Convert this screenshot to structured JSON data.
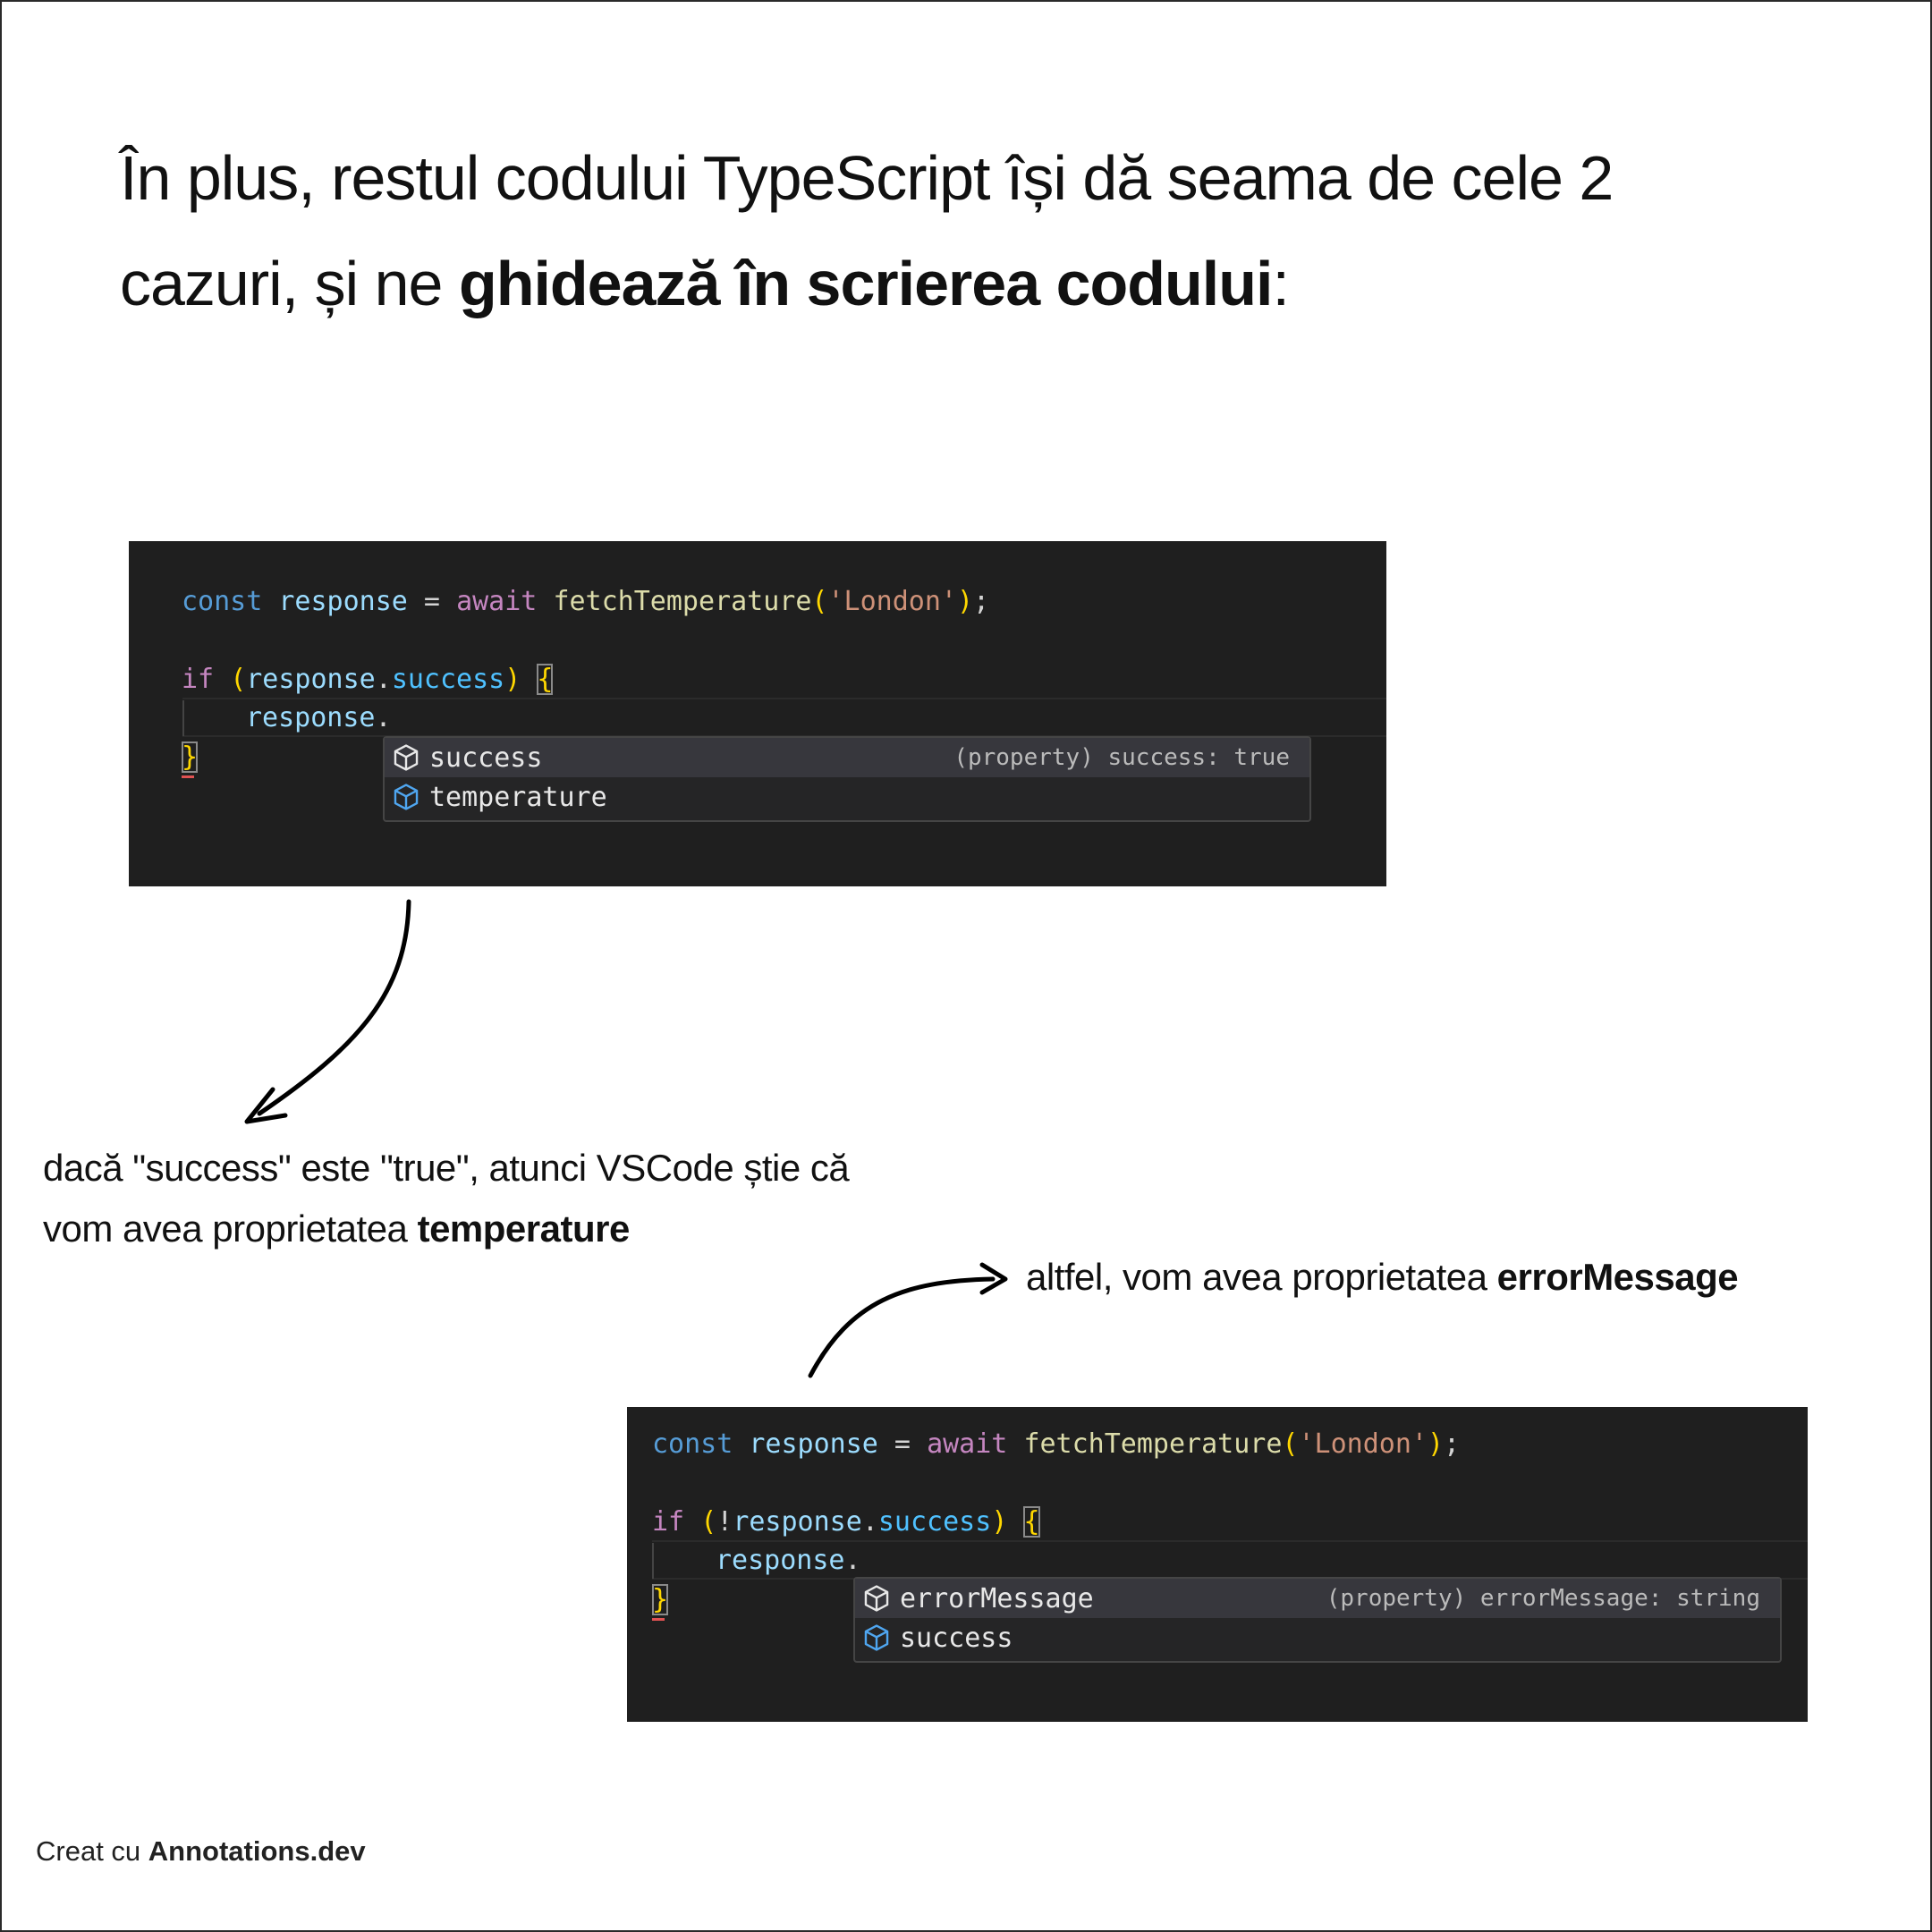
{
  "headline": {
    "line1": "În plus,  restul codului TypeScript își dă seama de cele 2",
    "line2_start": "cazuri, și ne ",
    "line2_bold": "ghidează în scrierea codului",
    "line2_end": ":"
  },
  "code_block_1": {
    "l1": {
      "const": "const",
      "response": "response",
      "eq": " = ",
      "await": "await",
      "fn": "fetchTemperature",
      "open": "(",
      "str": "'London'",
      "close": ")",
      "semi": ";"
    },
    "l2": {
      "if": "if",
      "open": "(",
      "bang": "",
      "var": "response",
      "dot": ".",
      "prop": "success",
      "close": ")",
      "brace": "{"
    },
    "l3": {
      "var": "response",
      "dot": "."
    },
    "l4": {
      "brace": "}"
    },
    "suggestions": [
      {
        "label": "success",
        "detail": "(property) success: true",
        "selected": true
      },
      {
        "label": "temperature",
        "detail": "",
        "selected": false
      }
    ]
  },
  "code_block_2": {
    "l1": {
      "const": "const",
      "response": "response",
      "eq": " = ",
      "await": "await",
      "fn": "fetchTemperature",
      "open": "(",
      "str": "'London'",
      "close": ")",
      "semi": ";"
    },
    "l2": {
      "if": "if",
      "open": "(",
      "bang": "!",
      "var": "response",
      "dot": ".",
      "prop": "success",
      "close": ")",
      "brace": "{"
    },
    "l3": {
      "var": "response",
      "dot": "."
    },
    "l4": {
      "brace": "}"
    },
    "suggestions": [
      {
        "label": "errorMessage",
        "detail": "(property) errorMessage: string",
        "selected": true
      },
      {
        "label": "success",
        "detail": "",
        "selected": false
      }
    ]
  },
  "note_1": {
    "line1": "dacă \"success\" este \"true\", atunci VSCode știe că",
    "line2_start": "vom avea proprietatea ",
    "line2_bold": "temperature"
  },
  "note_2": {
    "start": "altfel, vom avea proprietatea ",
    "bold": "errorMessage"
  },
  "credit": {
    "prefix": "Creat cu ",
    "brand": "Annotations.dev"
  },
  "icons": {
    "suggestion_selected": "cube-icon",
    "suggestion_other": "cube-icon-blue"
  },
  "colors": {
    "editor_bg": "#1f1f1f",
    "keyword_blue": "#569cd6",
    "keyword_purple": "#c586c0",
    "variable": "#9cdcfe",
    "function": "#dcdcaa",
    "string": "#ce9178",
    "brace": "#ffd700"
  }
}
